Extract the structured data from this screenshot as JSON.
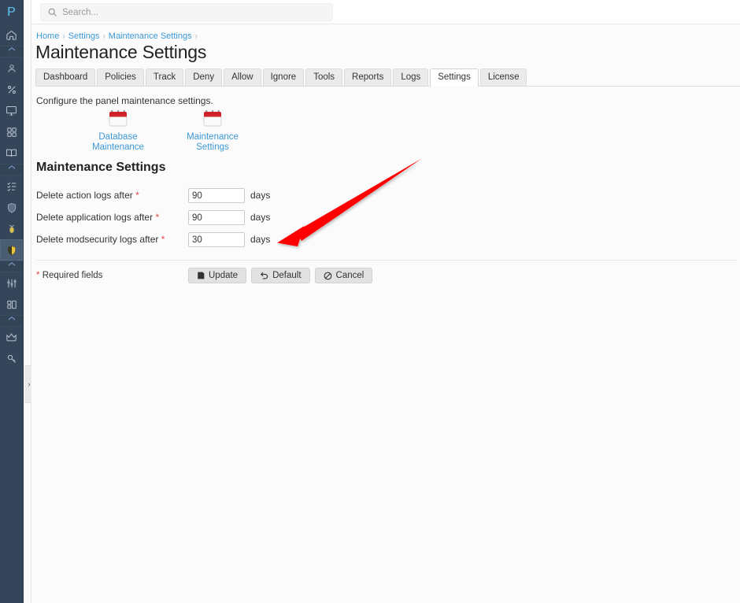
{
  "brand": {
    "logo_text": "P",
    "accent_color": "#5bc8f5",
    "sidebar_color": "#36465a",
    "link_color": "#3b98d6",
    "required_color": "#e04a4a",
    "annotation_color": "#fe0000"
  },
  "sidebar": {
    "items": [
      {
        "name": "home-icon",
        "label": "Home"
      },
      {
        "name": "caret-up-icon",
        "label": "Collapse"
      },
      {
        "name": "user-icon",
        "label": "Account"
      },
      {
        "name": "percent-icon",
        "label": "Billing"
      },
      {
        "name": "monitor-icon",
        "label": "Monitoring"
      },
      {
        "name": "grid-icon",
        "label": "Apps"
      },
      {
        "name": "book-icon",
        "label": "Docs"
      },
      {
        "name": "caret-up-icon",
        "label": "Collapse"
      },
      {
        "name": "checklist-icon",
        "label": "Tasks"
      },
      {
        "name": "shield-icon",
        "label": "Security"
      },
      {
        "name": "bug-icon",
        "label": "Malware"
      },
      {
        "name": "shield-lock-icon",
        "label": "Firewall"
      },
      {
        "name": "caret-up-icon",
        "label": "Collapse"
      },
      {
        "name": "sliders-icon",
        "label": "Settings"
      },
      {
        "name": "layout-icon",
        "label": "Layout"
      },
      {
        "name": "caret-up-icon",
        "label": "Collapse"
      },
      {
        "name": "crown-icon",
        "label": "Admin"
      },
      {
        "name": "key-icon",
        "label": "Access"
      }
    ],
    "toggle_label": "›"
  },
  "search": {
    "placeholder": "Search...",
    "value": "",
    "icon": "search-icon"
  },
  "breadcrumb": {
    "items": [
      "Home",
      "Settings",
      "Maintenance Settings"
    ],
    "separator": "›"
  },
  "header": {
    "title": "Maintenance Settings"
  },
  "tabs": [
    {
      "label": "Dashboard",
      "active": false
    },
    {
      "label": "Policies",
      "active": false
    },
    {
      "label": "Track",
      "active": false
    },
    {
      "label": "Deny",
      "active": false
    },
    {
      "label": "Allow",
      "active": false
    },
    {
      "label": "Ignore",
      "active": false
    },
    {
      "label": "Tools",
      "active": false
    },
    {
      "label": "Reports",
      "active": false
    },
    {
      "label": "Logs",
      "active": false
    },
    {
      "label": "Settings",
      "active": true
    },
    {
      "label": "License",
      "active": false
    }
  ],
  "main": {
    "intro": "Configure the panel maintenance settings.",
    "shortcuts": [
      {
        "line1": "Database",
        "line2": "Maintenance",
        "icon": "calendar-icon"
      },
      {
        "line1": "Maintenance",
        "line2": "Settings",
        "icon": "calendar-icon"
      }
    ],
    "section_title": "Maintenance Settings",
    "fields": [
      {
        "label": "Delete action logs after",
        "required": "*",
        "value": "90",
        "unit": "days"
      },
      {
        "label": "Delete application logs after",
        "required": "*",
        "value": "90",
        "unit": "days"
      },
      {
        "label": "Delete modsecurity logs after",
        "required": "*",
        "value": "30",
        "unit": "days"
      }
    ],
    "required_note_star": "*",
    "required_note_text": "Required fields",
    "buttons": [
      {
        "label": "Update",
        "icon": "save-icon"
      },
      {
        "label": "Default",
        "icon": "undo-icon"
      },
      {
        "label": "Cancel",
        "icon": "ban-icon"
      }
    ]
  }
}
